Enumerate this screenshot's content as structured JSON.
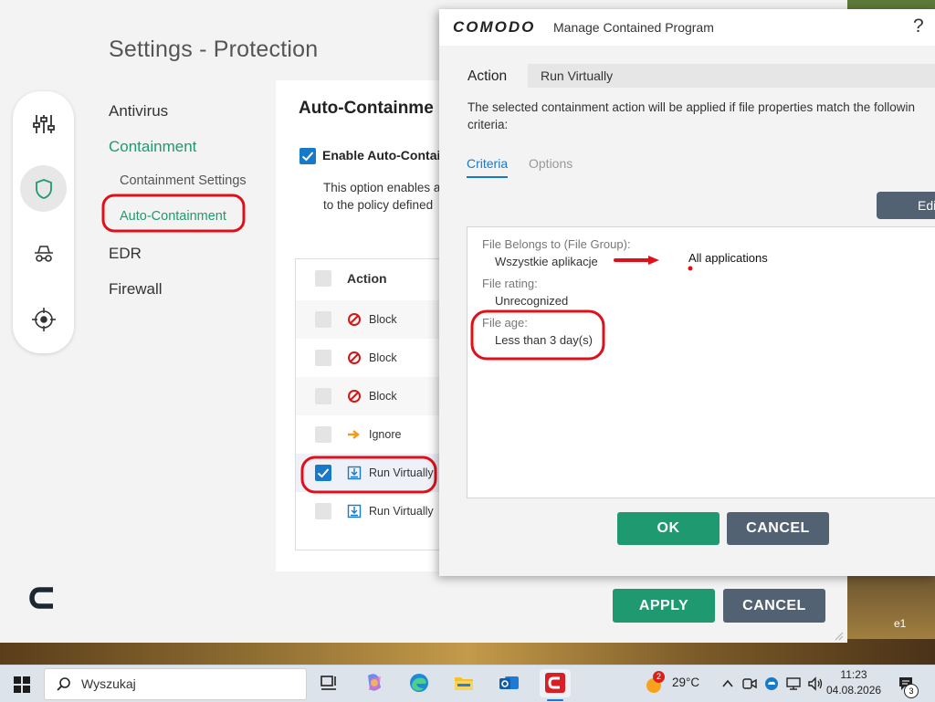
{
  "settings": {
    "title": "Settings - Protection",
    "nav": {
      "antivirus": "Antivirus",
      "containment": "Containment",
      "containment_settings": "Containment Settings",
      "auto_containment": "Auto-Containment",
      "edr": "EDR",
      "firewall": "Firewall"
    },
    "panel_title": "Auto-Containme",
    "enable_label": "Enable Auto-Contai",
    "description": [
      "This option enables a",
      "to the policy defined"
    ],
    "table": {
      "header": "Action",
      "rows": [
        {
          "action": "Block",
          "icon": "block-icon",
          "checked": false
        },
        {
          "action": "Block",
          "icon": "block-icon",
          "checked": false
        },
        {
          "action": "Block",
          "icon": "block-icon",
          "checked": false
        },
        {
          "action": "Ignore",
          "icon": "arrow-right-icon",
          "checked": false
        },
        {
          "action": "Run Virtually",
          "icon": "download-box-icon",
          "checked": true
        },
        {
          "action": "Run Virtually",
          "icon": "download-box-icon",
          "checked": false
        }
      ]
    },
    "apply_label": "APPLY",
    "cancel_label": "CANCEL"
  },
  "dialog": {
    "brand": "COMODO",
    "title": "Manage Contained Program",
    "help": "?",
    "action_label": "Action",
    "action_value": "Run Virtually",
    "description": [
      "The selected containment action will be applied if file properties match the followin",
      "criteria:"
    ],
    "tabs": [
      "Criteria",
      "Options"
    ],
    "edit_label": "Edi",
    "criteria": [
      {
        "key": "File Belongs to (File Group):",
        "value": "Wszystkie aplikacje"
      },
      {
        "key": "File rating:",
        "value": "Unrecognized"
      },
      {
        "key": "File age:",
        "value": "Less than 3 day(s)"
      }
    ],
    "annotation": "All applications",
    "ok_label": "OK",
    "cancel_label": "CANCEL"
  },
  "desktop_text": "e1",
  "taskbar": {
    "search_placeholder": "Wyszukaj",
    "weather_badge": "2",
    "weather_temp": "29°C",
    "time": "11:23",
    "date": "04.08.2026",
    "notification_count": "3"
  },
  "colors": {
    "accent_green": "#1f9a70",
    "accent_blue": "#1879c9",
    "button_grey": "#536272",
    "annotation_red": "#e0101a"
  }
}
